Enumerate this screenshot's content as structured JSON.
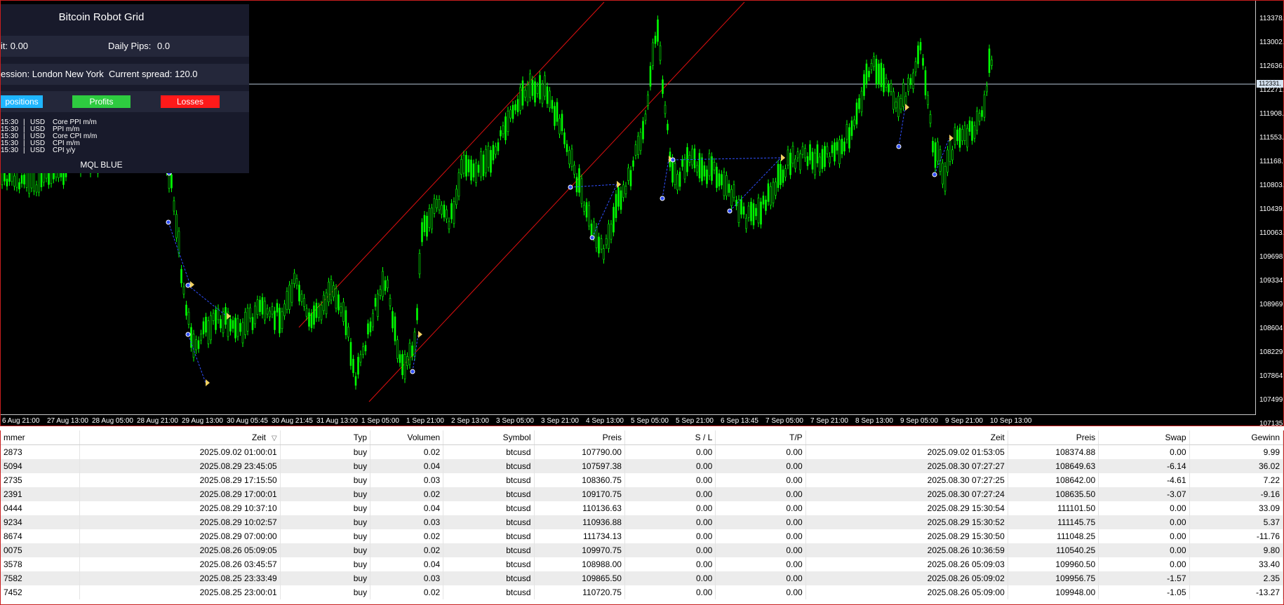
{
  "ea_panel": {
    "title": "Bitcoin Robot Grid",
    "profit_label": "it: 0.00",
    "daily_pips_label": "Daily Pips:",
    "daily_pips_value": "0.0",
    "session_text": "ession: London New York",
    "spread_label": "Current spread:",
    "spread_value": "120.0",
    "buttons": {
      "positions": "positions",
      "profits": "Profits",
      "losses": "Losses"
    },
    "news": [
      {
        "time": "15:30",
        "currency": "USD",
        "event": "Core PPI m/m"
      },
      {
        "time": "15:30",
        "currency": "USD",
        "event": "PPI m/m"
      },
      {
        "time": "15:30",
        "currency": "USD",
        "event": "Core CPI m/m"
      },
      {
        "time": "15:30",
        "currency": "USD",
        "event": "CPI m/m"
      },
      {
        "time": "15:30",
        "currency": "USD",
        "event": "CPI y/y"
      }
    ],
    "footer": "MQL BLUE",
    "colors": {
      "positions": "#1fb6ff",
      "profits": "#2ecc40",
      "losses": "#ff1a1a",
      "panel": "#181a2b"
    }
  },
  "chart": {
    "current_price": "112331.",
    "price_labels": [
      "113378.",
      "113002.",
      "112636.",
      "112271.",
      "111908.",
      "111553.",
      "111168.",
      "110803.",
      "110439.",
      "110063.",
      "109698.",
      "109334.",
      "108969.",
      "108604.",
      "108229.",
      "107864.",
      "107499.",
      "107135."
    ],
    "time_labels": [
      "6 Aug 21:00",
      "27 Aug 13:00",
      "28 Aug 05:00",
      "28 Aug 21:00",
      "29 Aug 13:00",
      "30 Aug 05:45",
      "30 Aug 21:45",
      "31 Aug 13:00",
      "1 Sep 05:00",
      "1 Sep 21:00",
      "2 Sep 13:00",
      "3 Sep 05:00",
      "3 Sep 21:00",
      "4 Sep 13:00",
      "5 Sep 05:00",
      "5 Sep 21:00",
      "6 Sep 13:45",
      "7 Sep 05:00",
      "7 Sep 21:00",
      "8 Sep 13:00",
      "9 Sep 05:00",
      "9 Sep 21:00",
      "10 Sep 13:00"
    ],
    "colors": {
      "candles": "#00ff00",
      "channel": "#e01010",
      "trades": "#3050ff",
      "background": "#000000"
    }
  },
  "table": {
    "columns": [
      "mmer",
      "Zeit",
      "Typ",
      "Volumen",
      "Symbol",
      "Preis",
      "S / L",
      "T/P",
      "Zeit",
      "Preis",
      "Swap",
      "Gewinn"
    ],
    "sort_indicator": "▽",
    "rows": [
      [
        "2873",
        "2025.09.02 01:00:01",
        "buy",
        "0.02",
        "btcusd",
        "107790.00",
        "0.00",
        "0.00",
        "2025.09.02 01:53:05",
        "108374.88",
        "0.00",
        "9.99"
      ],
      [
        "5094",
        "2025.08.29 23:45:05",
        "buy",
        "0.04",
        "btcusd",
        "107597.38",
        "0.00",
        "0.00",
        "2025.08.30 07:27:27",
        "108649.63",
        "-6.14",
        "36.02"
      ],
      [
        "2735",
        "2025.08.29 17:15:50",
        "buy",
        "0.03",
        "btcusd",
        "108360.75",
        "0.00",
        "0.00",
        "2025.08.30 07:27:25",
        "108642.00",
        "-4.61",
        "7.22"
      ],
      [
        "2391",
        "2025.08.29 17:00:01",
        "buy",
        "0.02",
        "btcusd",
        "109170.75",
        "0.00",
        "0.00",
        "2025.08.30 07:27:24",
        "108635.50",
        "-3.07",
        "-9.16"
      ],
      [
        "0444",
        "2025.08.29 10:37:10",
        "buy",
        "0.04",
        "btcusd",
        "110136.63",
        "0.00",
        "0.00",
        "2025.08.29 15:30:54",
        "111101.50",
        "0.00",
        "33.09"
      ],
      [
        "9234",
        "2025.08.29 10:02:57",
        "buy",
        "0.03",
        "btcusd",
        "110936.88",
        "0.00",
        "0.00",
        "2025.08.29 15:30:52",
        "111145.75",
        "0.00",
        "5.37"
      ],
      [
        "8674",
        "2025.08.29 07:00:00",
        "buy",
        "0.02",
        "btcusd",
        "111734.13",
        "0.00",
        "0.00",
        "2025.08.29 15:30:50",
        "111048.25",
        "0.00",
        "-11.76"
      ],
      [
        "0075",
        "2025.08.26 05:09:05",
        "buy",
        "0.02",
        "btcusd",
        "109970.75",
        "0.00",
        "0.00",
        "2025.08.26 10:36:59",
        "110540.25",
        "0.00",
        "9.80"
      ],
      [
        "3578",
        "2025.08.26 03:45:57",
        "buy",
        "0.04",
        "btcusd",
        "108988.00",
        "0.00",
        "0.00",
        "2025.08.26 05:09:03",
        "109960.50",
        "0.00",
        "33.40"
      ],
      [
        "7582",
        "2025.08.25 23:33:49",
        "buy",
        "0.03",
        "btcusd",
        "109865.50",
        "0.00",
        "0.00",
        "2025.08.26 05:09:02",
        "109956.75",
        "-1.57",
        "2.35"
      ],
      [
        "7452",
        "2025.08.25 23:00:01",
        "buy",
        "0.02",
        "btcusd",
        "110720.75",
        "0.00",
        "0.00",
        "2025.08.26 05:09:00",
        "109948.00",
        "-1.05",
        "-13.27"
      ]
    ]
  }
}
